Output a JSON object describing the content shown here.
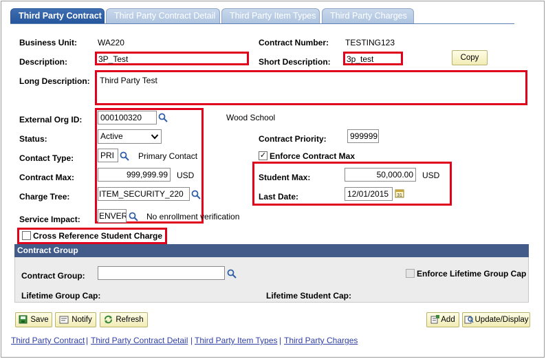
{
  "tabs": [
    "Third Party Contract",
    "Third Party Contract Detail",
    "Third Party Item Types",
    "Third Party Charges"
  ],
  "form": {
    "business_unit_label": "Business Unit:",
    "business_unit_value": "WA220",
    "contract_number_label": "Contract Number:",
    "contract_number_value": "TESTING123",
    "description_label": "Description:",
    "description_value": "3P_Test",
    "short_description_label": "Short Description:",
    "short_description_value": "3p_test",
    "copy_label": "Copy",
    "long_description_label": "Long Description:",
    "long_description_value": "Third Party Test",
    "external_org_label": "External Org ID:",
    "external_org_value": "000100320",
    "external_org_name": "Wood School",
    "status_label": "Status:",
    "status_value": "Active",
    "contract_priority_label": "Contract Priority:",
    "contract_priority_value": "999999",
    "contact_type_label": "Contact Type:",
    "contact_type_value": "PRI",
    "contact_type_desc": "Primary Contact",
    "enforce_contract_max_label": "Enforce Contract Max",
    "enforce_contract_max_checked": true,
    "contract_max_label": "Contract Max:",
    "contract_max_value": "999,999.99",
    "contract_max_currency": "USD",
    "student_max_label": "Student Max:",
    "student_max_value": "50,000.00",
    "student_max_currency": "USD",
    "charge_tree_label": "Charge Tree:",
    "charge_tree_value": "ITEM_SECURITY_220",
    "last_date_label": "Last Date:",
    "last_date_value": "12/01/2015",
    "service_impact_label": "Service Impact:",
    "service_impact_value": "ENVER",
    "service_impact_desc": "No enrollment verification",
    "cross_reference_label": "Cross Reference Student Charge",
    "cross_reference_checked": false
  },
  "contract_group": {
    "header": "Contract Group",
    "group_label": "Contract Group:",
    "group_value": "",
    "enforce_lifetime_label": "Enforce Lifetime Group Cap",
    "lifetime_group_cap_label": "Lifetime Group Cap:",
    "lifetime_student_cap_label": "Lifetime Student Cap:"
  },
  "toolbar": {
    "save": "Save",
    "notify": "Notify",
    "refresh": "Refresh",
    "add": "Add",
    "update_display": "Update/Display"
  },
  "links": [
    "Third Party Contract",
    "Third Party Contract Detail",
    "Third Party Item Types",
    "Third Party Charges"
  ],
  "link_separator": "|",
  "colors": {
    "accent_red": "#e0001b",
    "tab_active": "#24549a",
    "group_header": "#425b89",
    "link": "#2f3fa5"
  }
}
